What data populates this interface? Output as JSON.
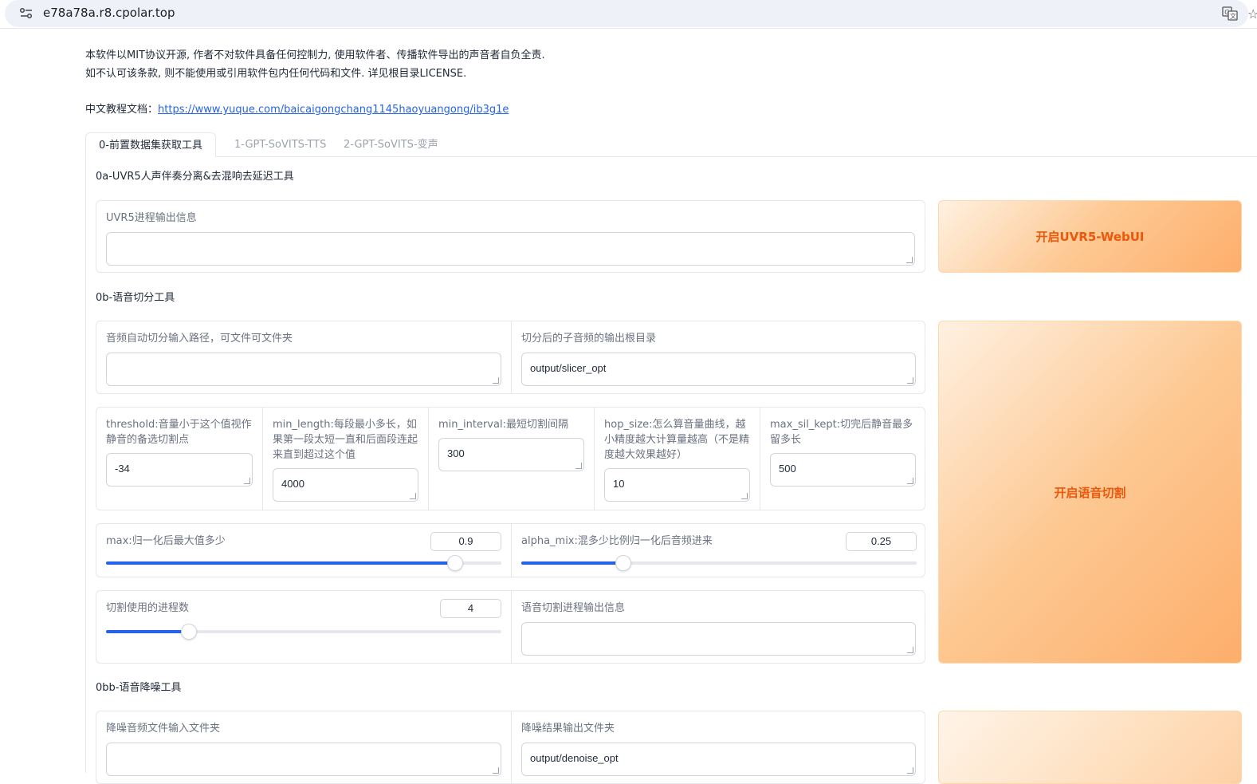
{
  "browser": {
    "url": "e78a78a.r8.cpolar.top"
  },
  "intro": {
    "line1": "本软件以MIT协议开源, 作者不对软件具备任何控制力, 使用软件者、传播软件导出的声音者自负全责.",
    "line2": "如不认可该条款, 则不能使用或引用软件包内任何代码和文件. 详见根目录LICENSE.",
    "doc_label": "中文教程文档：",
    "doc_link": "https://www.yuque.com/baicaigongchang1145haoyuangong/ib3g1e"
  },
  "tabs": [
    {
      "label": "0-前置数据集获取工具",
      "active": true
    },
    {
      "label": "1-GPT-SoVITS-TTS",
      "active": false
    },
    {
      "label": "2-GPT-SoVITS-变声",
      "active": false
    }
  ],
  "uvr5": {
    "title": "0a-UVR5人声伴奏分离&去混响去延迟工具",
    "output_label": "UVR5进程输出信息",
    "output_value": "",
    "button_label": "开启UVR5-WebUI"
  },
  "slicer": {
    "title": "0b-语音切分工具",
    "input_path_label": "音频自动切分输入路径，可文件可文件夹",
    "input_path_value": "",
    "output_dir_label": "切分后的子音频的输出根目录",
    "output_dir_value": "output/slicer_opt",
    "params": [
      {
        "label": "threshold:音量小于这个值视作静音的备选切割点",
        "value": "-34"
      },
      {
        "label": "min_length:每段最小多长，如果第一段太短一直和后面段连起来直到超过这个值",
        "value": "4000"
      },
      {
        "label": "min_interval:最短切割间隔",
        "value": "300"
      },
      {
        "label": "hop_size:怎么算音量曲线，越小精度越大计算量越高（不是精度越大效果越好）",
        "value": "10"
      },
      {
        "label": "max_sil_kept:切完后静音最多留多长",
        "value": "500"
      }
    ],
    "max_label": "max:归一化后最大值多少",
    "max_value": "0.9",
    "max_fraction": 0.884,
    "alpha_label": "alpha_mix:混多少比例归一化后音频进来",
    "alpha_value": "0.25",
    "alpha_fraction": 0.259,
    "procs_label": "切割使用的进程数",
    "procs_value": "4",
    "procs_fraction": 0.21,
    "log_label": "语音切割进程输出信息",
    "log_value": "",
    "button_label": "开启语音切割"
  },
  "denoise": {
    "title": "0bb-语音降噪工具",
    "input_label": "降噪音频文件输入文件夹",
    "input_value": "",
    "output_label": "降噪结果输出文件夹",
    "output_value": "output/denoise_opt"
  },
  "colors": {
    "accent": "#2563eb",
    "button_text": "#ea580c",
    "button_bg": "#fdc892"
  }
}
